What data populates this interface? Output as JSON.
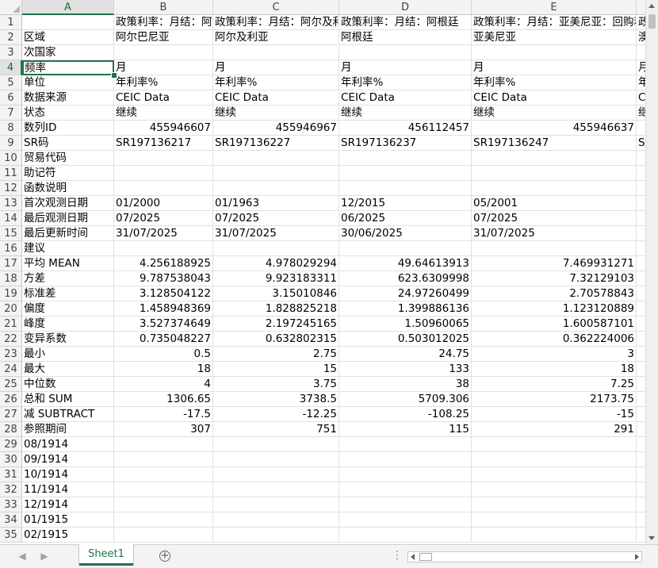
{
  "columns": [
    "A",
    "B",
    "C",
    "D",
    "E"
  ],
  "selected_column": "A",
  "selected_row": "4",
  "rows": [
    {
      "n": "1",
      "cells": [
        "",
        "政策利率：月结：阿尔巴尼亚",
        "政策利率：月结：阿尔及利亚",
        "政策利率：月结：阿根廷",
        "政策利率：月结：亚美尼亚：回购利率",
        "政"
      ]
    },
    {
      "n": "2",
      "cells": [
        "区域",
        "阿尔巴尼亚",
        "阿尔及利亚",
        "阿根廷",
        "亚美尼亚",
        "澳"
      ]
    },
    {
      "n": "3",
      "cells": [
        "次国家",
        "",
        "",
        "",
        "",
        ""
      ]
    },
    {
      "n": "4",
      "cells": [
        "频率",
        "月",
        "月",
        "月",
        "月",
        "月"
      ]
    },
    {
      "n": "5",
      "cells": [
        "单位",
        "年利率%",
        "年利率%",
        "年利率%",
        "年利率%",
        "年"
      ]
    },
    {
      "n": "6",
      "cells": [
        "数据来源",
        "CEIC Data",
        "CEIC Data",
        "CEIC Data",
        "CEIC Data",
        "C"
      ]
    },
    {
      "n": "7",
      "cells": [
        "状态",
        "继续",
        "继续",
        "继续",
        "继续",
        "继"
      ]
    },
    {
      "n": "8",
      "cells": [
        "数列ID",
        "455946607",
        "455946967",
        "456112457",
        "455946637",
        ""
      ]
    },
    {
      "n": "9",
      "cells": [
        "SR码",
        "SR197136217",
        "SR197136227",
        "SR197136237",
        "SR197136247",
        "S"
      ]
    },
    {
      "n": "10",
      "cells": [
        "贸易代码",
        "",
        "",
        "",
        "",
        ""
      ]
    },
    {
      "n": "11",
      "cells": [
        "助记符",
        "",
        "",
        "",
        "",
        ""
      ]
    },
    {
      "n": "12",
      "cells": [
        "函数说明",
        "",
        "",
        "",
        "",
        ""
      ]
    },
    {
      "n": "13",
      "cells": [
        "首次观测日期",
        "01/2000",
        "01/1963",
        "12/2015",
        "05/2001",
        "0"
      ]
    },
    {
      "n": "14",
      "cells": [
        "最后观测日期",
        "07/2025",
        "07/2025",
        "06/2025",
        "07/2025",
        "0"
      ]
    },
    {
      "n": "15",
      "cells": [
        "最后更新时间",
        "31/07/2025",
        "31/07/2025",
        "30/06/2025",
        "31/07/2025",
        "3"
      ]
    },
    {
      "n": "16",
      "cells": [
        "建议",
        "",
        "",
        "",
        "",
        ""
      ]
    },
    {
      "n": "17",
      "cells": [
        "平均 MEAN",
        "4.256188925",
        "4.978029294",
        "49.64613913",
        "7.469931271",
        ""
      ]
    },
    {
      "n": "18",
      "cells": [
        "方差",
        "9.787538043",
        "9.923183311",
        "623.6309998",
        "7.32129103",
        ""
      ]
    },
    {
      "n": "19",
      "cells": [
        "标准差",
        "3.128504122",
        "3.15010846",
        "24.97260499",
        "2.70578843",
        ""
      ]
    },
    {
      "n": "20",
      "cells": [
        "偏度",
        "1.458948369",
        "1.828825218",
        "1.399886136",
        "1.123120889",
        ""
      ]
    },
    {
      "n": "21",
      "cells": [
        "峰度",
        "3.527374649",
        "2.197245165",
        "1.50960065",
        "1.600587101",
        ""
      ]
    },
    {
      "n": "22",
      "cells": [
        "变异系数",
        "0.735048227",
        "0.632802315",
        "0.503012025",
        "0.362224006",
        ""
      ]
    },
    {
      "n": "23",
      "cells": [
        "最小",
        "0.5",
        "2.75",
        "24.75",
        "3",
        ""
      ]
    },
    {
      "n": "24",
      "cells": [
        "最大",
        "18",
        "15",
        "133",
        "18",
        ""
      ]
    },
    {
      "n": "25",
      "cells": [
        "中位数",
        "4",
        "3.75",
        "38",
        "7.25",
        ""
      ]
    },
    {
      "n": "26",
      "cells": [
        "总和 SUM",
        "1306.65",
        "3738.5",
        "5709.306",
        "2173.75",
        ""
      ]
    },
    {
      "n": "27",
      "cells": [
        "减 SUBTRACT",
        "-17.5",
        "-12.25",
        "-108.25",
        "-15",
        ""
      ]
    },
    {
      "n": "28",
      "cells": [
        "参照期间",
        "307",
        "751",
        "115",
        "291",
        ""
      ]
    },
    {
      "n": "29",
      "cells": [
        "08/1914",
        "",
        "",
        "",
        "",
        ""
      ]
    },
    {
      "n": "30",
      "cells": [
        "09/1914",
        "",
        "",
        "",
        "",
        ""
      ]
    },
    {
      "n": "31",
      "cells": [
        "10/1914",
        "",
        "",
        "",
        "",
        ""
      ]
    },
    {
      "n": "32",
      "cells": [
        "11/1914",
        "",
        "",
        "",
        "",
        ""
      ]
    },
    {
      "n": "33",
      "cells": [
        "12/1914",
        "",
        "",
        "",
        "",
        ""
      ]
    },
    {
      "n": "34",
      "cells": [
        "01/1915",
        "",
        "",
        "",
        "",
        ""
      ]
    },
    {
      "n": "35",
      "cells": [
        "02/1915",
        "",
        "",
        "",
        "",
        ""
      ]
    }
  ],
  "numeric_rows_from": 8,
  "sheet_tab": "Sheet1",
  "add_sheet_symbol": "+",
  "more_symbol": "⋮",
  "accent_color": "#217346"
}
